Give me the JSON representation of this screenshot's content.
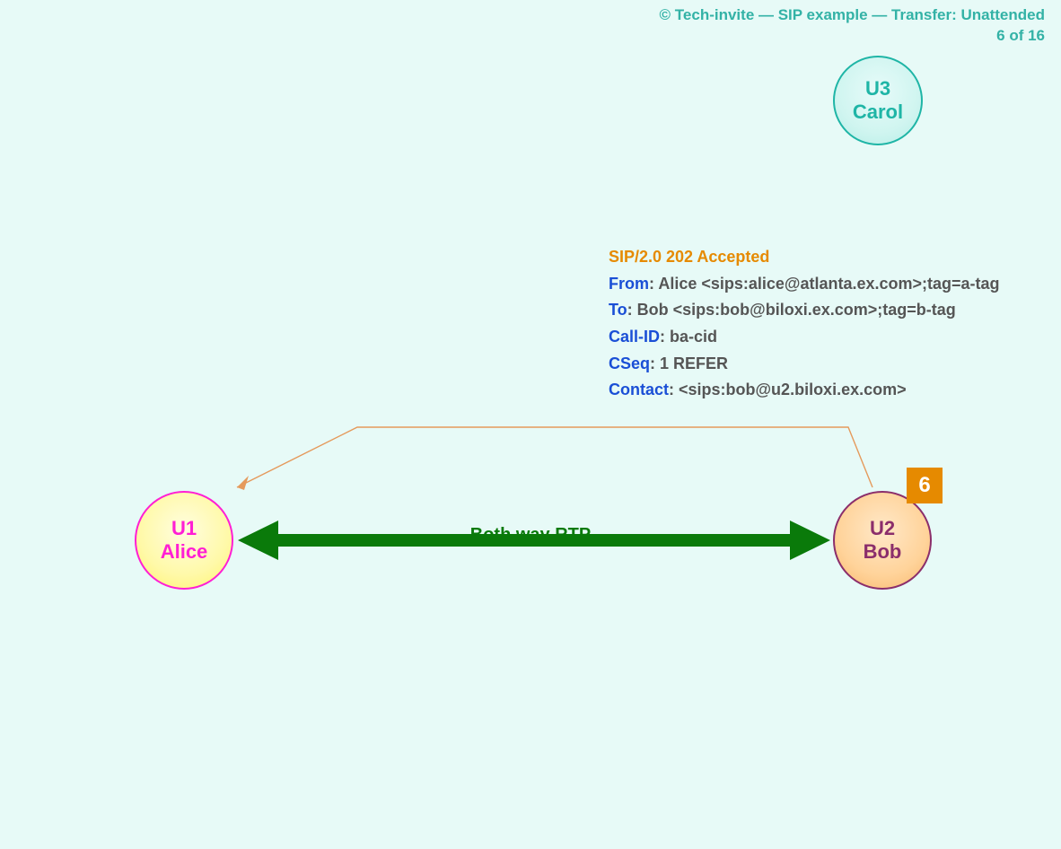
{
  "header": {
    "line1": "© Tech-invite — SIP example — Transfer: Unattended",
    "line2": "6 of 16"
  },
  "nodes": {
    "u1": {
      "id": "U1",
      "name": "Alice"
    },
    "u2": {
      "id": "U2",
      "name": "Bob"
    },
    "u3": {
      "id": "U3",
      "name": "Carol"
    }
  },
  "step_badge": "6",
  "rtp_label": "Both way RTP",
  "sip_message": {
    "status": "SIP/2.0 202 Accepted",
    "headers": [
      {
        "key": "From",
        "sep": ": ",
        "val": "Alice <sips:alice@atlanta.ex.com>;tag=a-tag"
      },
      {
        "key": "To",
        "sep": ": ",
        "val": "Bob <sips:bob@biloxi.ex.com>;tag=b-tag"
      },
      {
        "key": "Call-ID",
        "sep": ": ",
        "val": "ba-cid"
      },
      {
        "key": "CSeq",
        "sep": ": ",
        "val": "1 REFER"
      },
      {
        "key": "Contact",
        "sep": ": ",
        "val": "<sips:bob@u2.biloxi.ex.com>"
      }
    ]
  },
  "colors": {
    "accent_teal": "#33b2a6",
    "accent_orange": "#e68a00",
    "accent_green": "#0a7a0a",
    "accent_blue": "#1a4fd6",
    "accent_pink": "#ff1fd4",
    "accent_purple": "#8b2e6b",
    "msg_arrow": "#e59a5c"
  }
}
